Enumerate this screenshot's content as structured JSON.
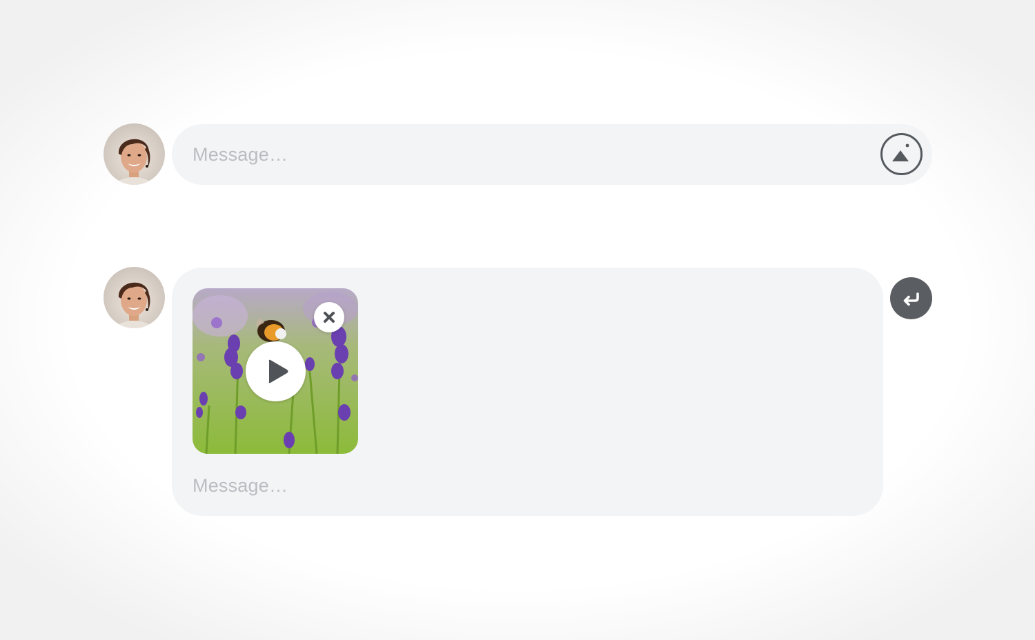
{
  "composer_compact": {
    "placeholder": "Message…",
    "attach_icon": "image-icon"
  },
  "composer_expanded": {
    "placeholder": "Message…",
    "attachment": {
      "type": "video",
      "play_icon": "play-icon",
      "remove_icon": "close-icon"
    },
    "send_icon": "enter-arrow-icon"
  },
  "colors": {
    "composer_background": "#f3f4f6",
    "placeholder": "#b9bcc1",
    "icon_dark": "#555a5f",
    "send_button": "#5a5d61"
  }
}
